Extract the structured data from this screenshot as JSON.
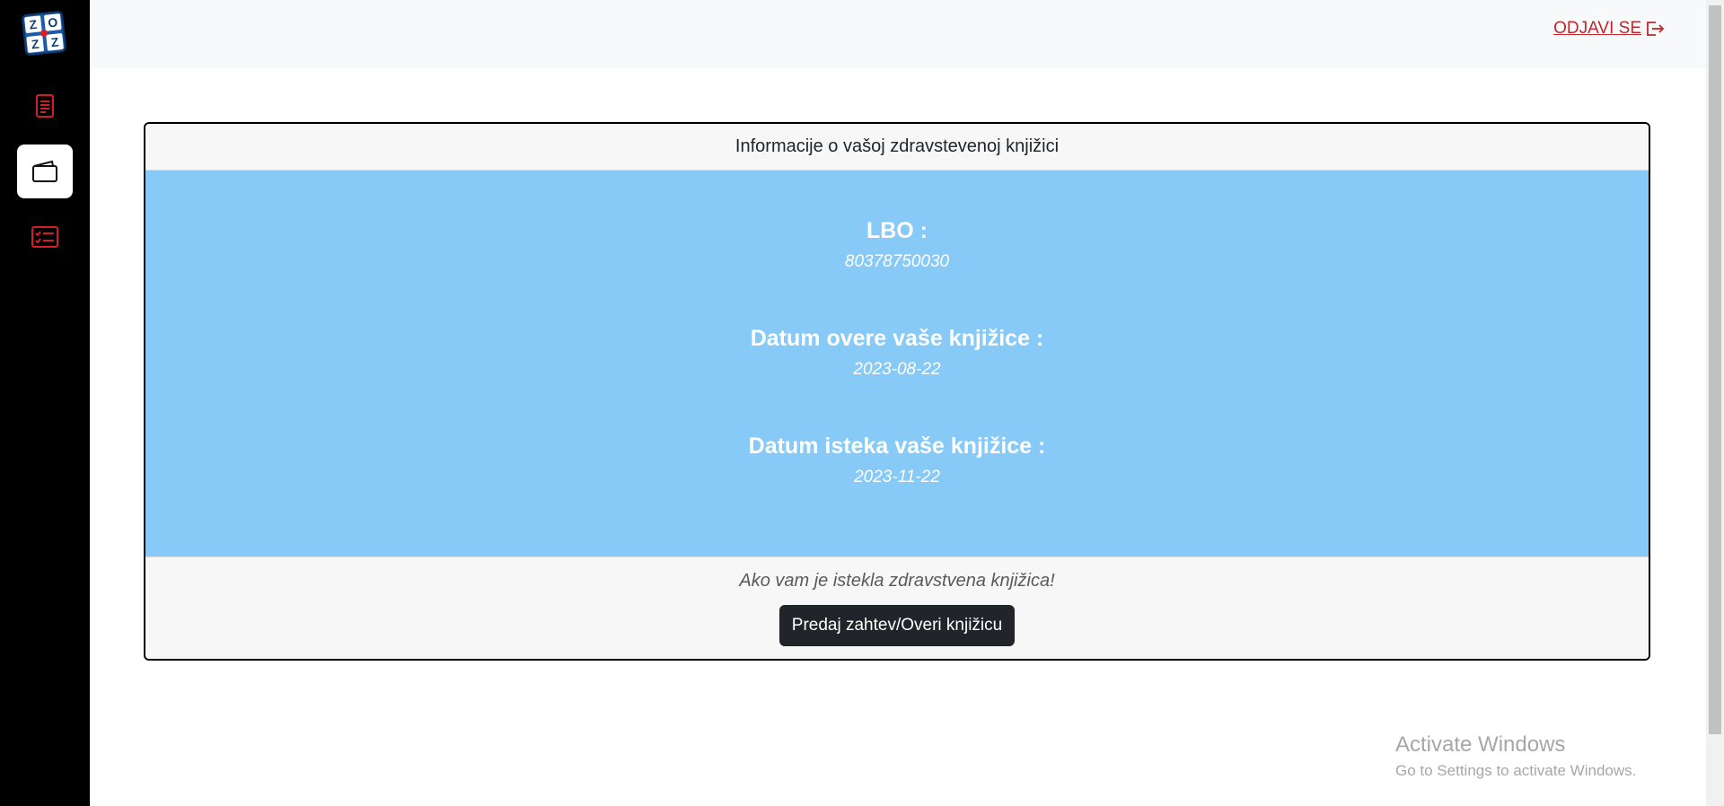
{
  "sidebar": {
    "logo": {
      "cells": [
        "Z",
        "O",
        "Z",
        "Z"
      ]
    },
    "items": [
      {
        "id": "document",
        "icon": "document-icon"
      },
      {
        "id": "card",
        "icon": "wallet-icon",
        "active": true
      },
      {
        "id": "checklist",
        "icon": "checklist-icon"
      }
    ]
  },
  "topbar": {
    "logout_label": "ODJAVI SE"
  },
  "card": {
    "header": "Informacije o vašoj zdravstevenoj knjižici",
    "fields": [
      {
        "label": "LBO :",
        "value": "80378750030"
      },
      {
        "label": "Datum overe vaše knjižice :",
        "value": "2023-08-22"
      },
      {
        "label": "Datum isteka vaše knjižice :",
        "value": "2023-11-22"
      }
    ],
    "footer_note": "Ako vam je istekla zdravstvena knjižica!",
    "button_label": "Predaj zahtev/Overi knjižicu"
  },
  "watermark": {
    "title": "Activate Windows",
    "subtitle": "Go to Settings to activate Windows."
  },
  "colors": {
    "accent_red": "#c1272d",
    "card_body": "#87c9f7",
    "button_dark": "#212529"
  }
}
